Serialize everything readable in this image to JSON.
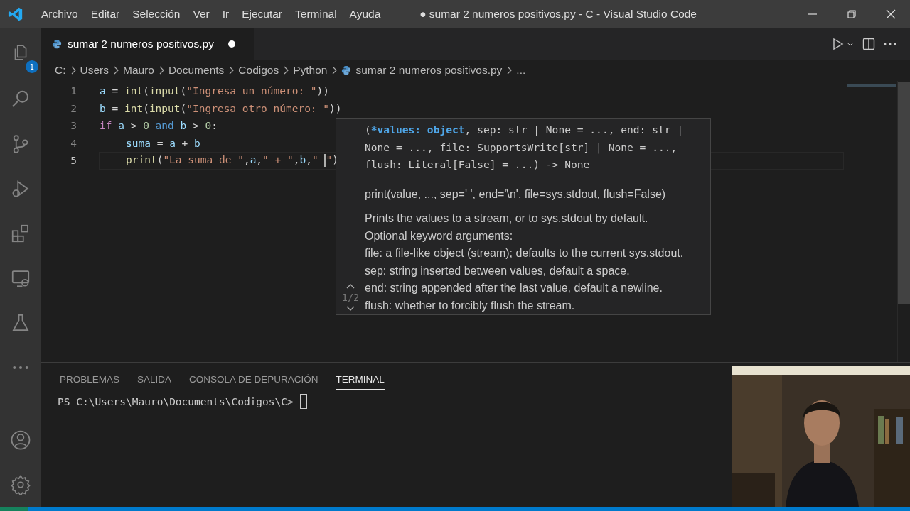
{
  "window": {
    "title": "● sumar 2 numeros positivos.py - C - Visual Studio Code"
  },
  "menu": [
    "Archivo",
    "Editar",
    "Selección",
    "Ver",
    "Ir",
    "Ejecutar",
    "Terminal",
    "Ayuda"
  ],
  "activity_bar": {
    "top": [
      {
        "kind": "explorer",
        "badge": "1"
      },
      {
        "kind": "search"
      },
      {
        "kind": "source-control"
      },
      {
        "kind": "run-debug"
      },
      {
        "kind": "extensions"
      },
      {
        "kind": "remote"
      },
      {
        "kind": "testing"
      },
      {
        "kind": "more"
      }
    ],
    "bottom": [
      {
        "kind": "account"
      },
      {
        "kind": "settings"
      }
    ]
  },
  "tabs": [
    {
      "label": "sumar 2 numeros positivos.py",
      "selected": true,
      "modified": true
    }
  ],
  "breadcrumb": [
    {
      "label": "C:",
      "kind": "folder"
    },
    {
      "label": "Users",
      "kind": "folder"
    },
    {
      "label": "Mauro",
      "kind": "folder"
    },
    {
      "label": "Documents",
      "kind": "folder"
    },
    {
      "label": "Codigos",
      "kind": "folder"
    },
    {
      "label": "Python",
      "kind": "folder"
    },
    {
      "label": "sumar 2 numeros positivos.py",
      "kind": "file"
    },
    {
      "label": "...",
      "kind": "symbol"
    }
  ],
  "editor": {
    "lines": [
      {
        "number": "1",
        "current": false,
        "indented": false,
        "tokens": [
          {
            "text": "a",
            "kind": "var"
          },
          {
            "text": " = ",
            "kind": "op"
          },
          {
            "text": "int",
            "kind": "func"
          },
          {
            "text": "(",
            "kind": "punct"
          },
          {
            "text": "input",
            "kind": "func"
          },
          {
            "text": "(",
            "kind": "punct"
          },
          {
            "text": "\"Ingresa un número: \"",
            "kind": "str"
          },
          {
            "text": "))",
            "kind": "punct"
          }
        ]
      },
      {
        "number": "2",
        "current": false,
        "indented": false,
        "tokens": [
          {
            "text": "b",
            "kind": "var"
          },
          {
            "text": " = ",
            "kind": "op"
          },
          {
            "text": "int",
            "kind": "func"
          },
          {
            "text": "(",
            "kind": "punct"
          },
          {
            "text": "input",
            "kind": "func"
          },
          {
            "text": "(",
            "kind": "punct"
          },
          {
            "text": "\"Ingresa otro número: \"",
            "kind": "str"
          },
          {
            "text": "))",
            "kind": "punct"
          }
        ]
      },
      {
        "number": "3",
        "current": false,
        "indented": false,
        "tokens": [
          {
            "text": "if",
            "kind": "control"
          },
          {
            "text": " a",
            "kind": "var"
          },
          {
            "text": " > ",
            "kind": "op"
          },
          {
            "text": "0",
            "kind": "num"
          },
          {
            "text": " and",
            "kind": "keyword"
          },
          {
            "text": " b",
            "kind": "var"
          },
          {
            "text": " > ",
            "kind": "op"
          },
          {
            "text": "0",
            "kind": "num"
          },
          {
            "text": ":",
            "kind": "punct"
          }
        ]
      },
      {
        "number": "4",
        "current": false,
        "indented": true,
        "tokens": [
          {
            "text": "suma",
            "kind": "var"
          },
          {
            "text": " = ",
            "kind": "op"
          },
          {
            "text": "a",
            "kind": "var"
          },
          {
            "text": " + ",
            "kind": "op"
          },
          {
            "text": "b",
            "kind": "var"
          }
        ]
      },
      {
        "number": "5",
        "current": true,
        "indented": true,
        "tokens": [
          {
            "text": "print",
            "kind": "func"
          },
          {
            "text": "(",
            "kind": "punct"
          },
          {
            "text": "\"La suma de \"",
            "kind": "str"
          },
          {
            "text": ",",
            "kind": "punct"
          },
          {
            "text": "a",
            "kind": "var"
          },
          {
            "text": ",",
            "kind": "punct"
          },
          {
            "text": "\" + \"",
            "kind": "str"
          },
          {
            "text": ",",
            "kind": "punct"
          },
          {
            "text": "b",
            "kind": "var"
          },
          {
            "text": ",",
            "kind": "punct"
          },
          {
            "text": "\" ",
            "kind": "str",
            "caret": true
          },
          {
            "text": "\"",
            "kind": "str"
          },
          {
            "text": ")",
            "kind": "punct"
          }
        ]
      }
    ]
  },
  "hover": {
    "signature": [
      {
        "text": "(",
        "active": false
      },
      {
        "text": "*values: object",
        "active": true
      },
      {
        "text": ", sep: str | None = ..., end: str | None = ..., file: SupportsWrite[str] | None = ..., flush: Literal[False] = ...) -> None",
        "active": false
      }
    ],
    "doc_title": "print(value, ..., sep=' ', end='\\n', file=sys.stdout, flush=False)",
    "doc_lines": [
      "Prints the values to a stream, or to sys.stdout by default.",
      "Optional keyword arguments:",
      "file: a file-like object (stream); defaults to the current sys.stdout.",
      "sep: string inserted between values, default a space.",
      "end: string appended after the last value, default a newline.",
      "flush: whether to forcibly flush the stream."
    ],
    "page": "1/2"
  },
  "panel": {
    "tabs": [
      {
        "label": "PROBLEMAS",
        "selected": false
      },
      {
        "label": "SALIDA",
        "selected": false
      },
      {
        "label": "CONSOLA DE DEPURACIÓN",
        "selected": false
      },
      {
        "label": "TERMINAL",
        "selected": true
      }
    ],
    "terminal": {
      "prompt": "PS C:\\Users\\Mauro\\Documents\\Codigos\\C>"
    }
  },
  "webcam": {
    "kind": "picture"
  }
}
